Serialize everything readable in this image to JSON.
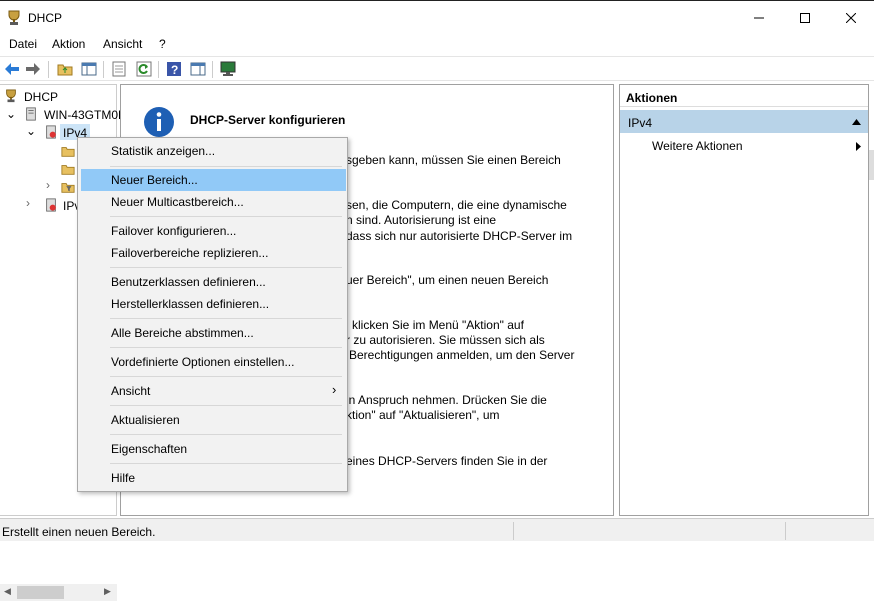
{
  "window": {
    "title": "DHCP"
  },
  "menubar": [
    "Datei",
    "Aktion",
    "Ansicht",
    "?"
  ],
  "tree": {
    "root": "DHCP",
    "server": "WIN-43GTM0E",
    "ipv4": "IPv4",
    "ipv6": "IPv"
  },
  "main": {
    "title": "DHCP-Server konfigurieren",
    "lines": [
      "sgeben kann, müssen Sie einen Bereich",
      "sen, die Computern, die eine dynamische",
      "n sind. Autorisierung ist eine",
      "dass sich nur autorisierte DHCP-Server im",
      "uer Bereich\", um einen neuen Bereich",
      "l klicken Sie im Menü \"Aktion\" auf",
      "r zu autorisieren. Sie müssen sich als",
      "Berechtigungen anmelden, um den Server",
      "in Anspruch nehmen. Drücken Sie die",
      "ktion\" auf \"Aktualisieren\", um",
      "eines DHCP-Servers finden Sie in der"
    ]
  },
  "actions": {
    "header": "Aktionen",
    "selected": "IPv4",
    "item": "Weitere Aktionen"
  },
  "context_menu": {
    "items": [
      {
        "label": "Statistik anzeigen..."
      },
      {
        "label": "Neuer Bereich...",
        "highlighted": true
      },
      {
        "label": "Neuer Multicastbereich..."
      },
      {
        "label": "Failover konfigurieren..."
      },
      {
        "label": "Failoverbereiche replizieren..."
      },
      {
        "label": "Benutzerklassen definieren..."
      },
      {
        "label": "Herstellerklassen definieren..."
      },
      {
        "label": "Alle Bereiche abstimmen..."
      },
      {
        "label": "Vordefinierte Optionen einstellen..."
      },
      {
        "label": "Ansicht",
        "submenu": true
      },
      {
        "label": "Aktualisieren"
      },
      {
        "label": "Eigenschaften"
      },
      {
        "label": "Hilfe"
      }
    ]
  },
  "statusbar": {
    "text": "Erstellt einen neuen Bereich."
  },
  "colors": {
    "highlight": "#91c9f7",
    "action_selected": "#b8d3e8",
    "info_icon": "#1e5fb4"
  }
}
